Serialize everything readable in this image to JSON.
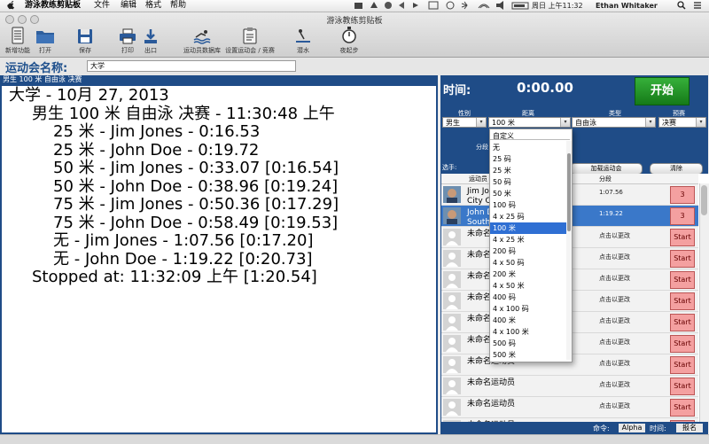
{
  "menubar": {
    "app_name": "游泳教练剪贴板",
    "menus": [
      "文件",
      "编辑",
      "格式",
      "帮助"
    ],
    "clock": "周日 上午11:32",
    "user": "Ethan Whitaker"
  },
  "window": {
    "title": "游泳教练剪贴板"
  },
  "toolbar": {
    "new_label": "新增功能",
    "open_label": "打开",
    "save_label": "保存",
    "print_label": "打印",
    "export_label": "出口",
    "athlete_db_label": "运动员数据库",
    "setup_meet_label": "设置运动会 / 竞赛",
    "dive_label": "潜水",
    "start_step_label": "夜起步"
  },
  "meet": {
    "label": "运动会名称:",
    "value": "大学"
  },
  "results_panel": {
    "header": "男生 100 米 自由泳 决赛",
    "lines": [
      "大学 - 10月 27, 2013",
      "男生 100 米 自由泳 决赛 - 11:30:48 上午",
      "25 米 - Jim Jones - 0:16.53",
      "25 米 - John Doe - 0:19.72",
      "50 米 - Jim Jones - 0:33.07 [0:16.54]",
      "50 米 - John Doe - 0:38.96 [0:19.24]",
      "75 米 - Jim Jones - 0:50.36 [0:17.29]",
      "75 米 - John Doe - 0:58.49 [0:19.53]",
      "无 - Jim Jones - 1:07.56 [0:17.20]",
      "无 - John Doe - 1:19.22 [0:20.73]",
      "Stopped at: 11:32:09 上午 [1:20.54]"
    ]
  },
  "timer": {
    "label": "时间:",
    "value": "0:00.00",
    "start_label": "开始"
  },
  "event": {
    "gender_label": "性别",
    "distance_label": "距离",
    "type_label": "类型",
    "round_label": "预赛",
    "gender_value": "男生",
    "distance_value": "100 米",
    "type_value": "自由泳",
    "round_value": "决赛",
    "split_label": "分段"
  },
  "swimmers_bar": {
    "label": "选手:",
    "load_label": "加载运动会",
    "clear_label": "清除"
  },
  "lanes": {
    "col_name": "运动员",
    "col_split": "分段",
    "rows": [
      {
        "name": "Jim Jones",
        "team": "City Club",
        "split": "1:07.56",
        "btn": "3"
      },
      {
        "name": "John Doe",
        "team": "South Bay",
        "split": "1:19.22",
        "btn": "3"
      },
      {
        "name": "未命名运动员",
        "team": "",
        "split": "点击以更改",
        "btn": "Start"
      },
      {
        "name": "未命名运动员",
        "team": "",
        "split": "点击以更改",
        "btn": "Start"
      },
      {
        "name": "未命名运动员",
        "team": "",
        "split": "点击以更改",
        "btn": "Start"
      },
      {
        "name": "未命名运动员",
        "team": "",
        "split": "点击以更改",
        "btn": "Start"
      },
      {
        "name": "未命名运动员",
        "team": "",
        "split": "点击以更改",
        "btn": "Start"
      },
      {
        "name": "未命名运动员",
        "team": "",
        "split": "点击以更改",
        "btn": "Start"
      },
      {
        "name": "未命名运动员",
        "team": "",
        "split": "点击以更改",
        "btn": "Start"
      },
      {
        "name": "未命名运动员",
        "team": "",
        "split": "点击以更改",
        "btn": "Start"
      },
      {
        "name": "未命名运动员",
        "team": "",
        "split": "点击以更改",
        "btn": "Start"
      },
      {
        "name": "未命名运动员",
        "team": "",
        "split": "点击以更改",
        "btn": "Start"
      }
    ]
  },
  "distance_dropdown": {
    "options": [
      "自定义",
      "无",
      "25 码",
      "25 米",
      "50 码",
      "50 米",
      "100 码",
      "4 x 25 码",
      "100 米",
      "4 x 25 米",
      "200 码",
      "4 x 50 码",
      "200 米",
      "4 x 50 米",
      "400 码",
      "4 x 100 码",
      "400 米",
      "4 x 100 米",
      "500 码",
      "500 米"
    ],
    "selected": "100 米"
  },
  "command_bar": {
    "label": "命令:",
    "alpha_label": "Alpha",
    "time_label": "时间:",
    "signup_label": "报名"
  }
}
